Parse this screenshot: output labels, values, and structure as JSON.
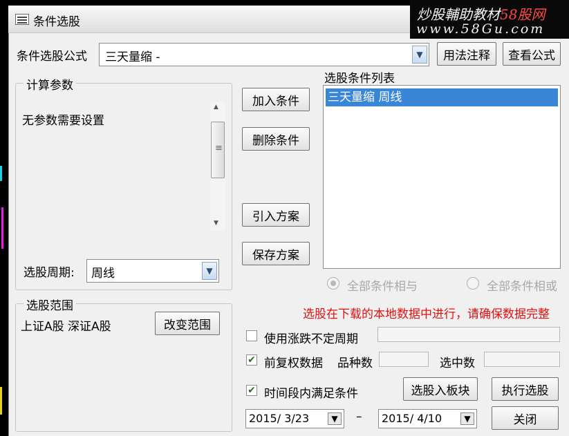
{
  "window": {
    "title": "条件选股"
  },
  "watermark": {
    "line1_prefix": "炒股輔助教材",
    "line1_accent": "58股网",
    "line2": "www.58Gu.com"
  },
  "formula": {
    "label": "条件选股公式",
    "value": "三天量缩  -",
    "usage_button": "用法注释",
    "view_button": "查看公式"
  },
  "params": {
    "group_label": "计算参数",
    "text": "无参数需要设置",
    "period_label": "选股周期:",
    "period_value": "周线"
  },
  "actions": {
    "add": "加入条件",
    "delete": "删除条件",
    "import": "引入方案",
    "save": "保存方案"
  },
  "conditions": {
    "label": "选股条件列表",
    "items": [
      "三天量缩   周线"
    ],
    "radio_and": "全部条件相与",
    "radio_or": "全部条件相或"
  },
  "scope": {
    "group_label": "选股范围",
    "value": "上证A股 深证A股",
    "change_button": "改变范围"
  },
  "note": "选股在下载的本地数据中进行，请确保数据完整",
  "options": {
    "use_variable_period": {
      "label": "使用涨跌不定周期",
      "checked": false
    },
    "pre_adjusted": {
      "label": "前复权数据",
      "checked": true
    },
    "variety_count_label": "品种数",
    "selected_count_label": "选中数",
    "period_condition": {
      "label": "时间段内满足条件",
      "checked": true
    }
  },
  "dates": {
    "start": "2015/ 3/23",
    "separator": "–",
    "end": "2015/ 4/10"
  },
  "buttons": {
    "to_block": "选股入板块",
    "execute": "执行选股",
    "close": "关闭"
  },
  "glyphs": {
    "dropdown": "▼",
    "check": "✔",
    "up": "▲",
    "down": "▼",
    "grip": "≡"
  }
}
